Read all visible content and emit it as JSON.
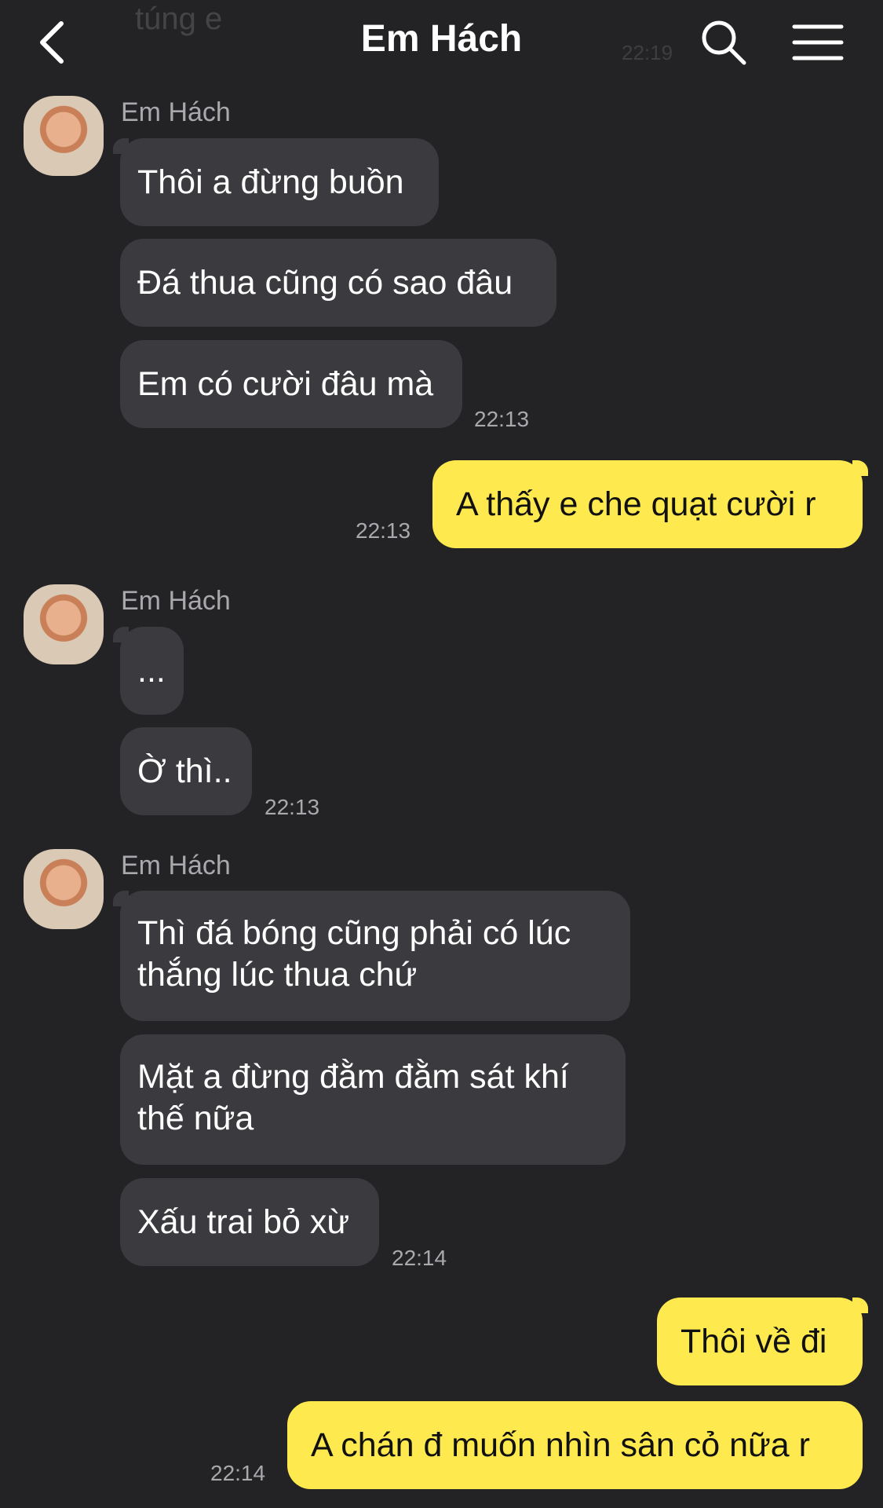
{
  "header": {
    "title": "Em Hách",
    "ghost_message": "túng e",
    "ghost_time": "22:19",
    "back_icon": "chevron-left-icon",
    "search_icon": "search-icon",
    "menu_icon": "hamburger-menu-icon"
  },
  "colors": {
    "background": "#232326",
    "incoming_bubble": "#3b3b3f",
    "outgoing_bubble": "#fee94e",
    "meta_text": "#a9a9ad"
  },
  "messages": {
    "group1": {
      "sender": "Em Hách",
      "lines": [
        "Thôi a đừng buồn",
        "Đá thua cũng có sao đâu",
        "Em có cười đâu mà"
      ],
      "time": "22:13"
    },
    "out1": {
      "text": "A thấy e che quạt cười r",
      "time": "22:13"
    },
    "group2": {
      "sender": "Em Hách",
      "lines": [
        "...",
        "Ờ thì.."
      ],
      "time": "22:13"
    },
    "group3": {
      "sender": "Em Hách",
      "lines": [
        "Thì đá bóng cũng phải có lúc thắng lúc thua chứ",
        "Mặt a đừng đằm đằm sát khí thế nữa",
        "Xấu trai bỏ xừ"
      ],
      "time": "22:14"
    },
    "out2": {
      "lines": [
        "Thôi về đi",
        "A chán đ muốn nhìn sân cỏ nữa r"
      ],
      "time": "22:14"
    }
  }
}
